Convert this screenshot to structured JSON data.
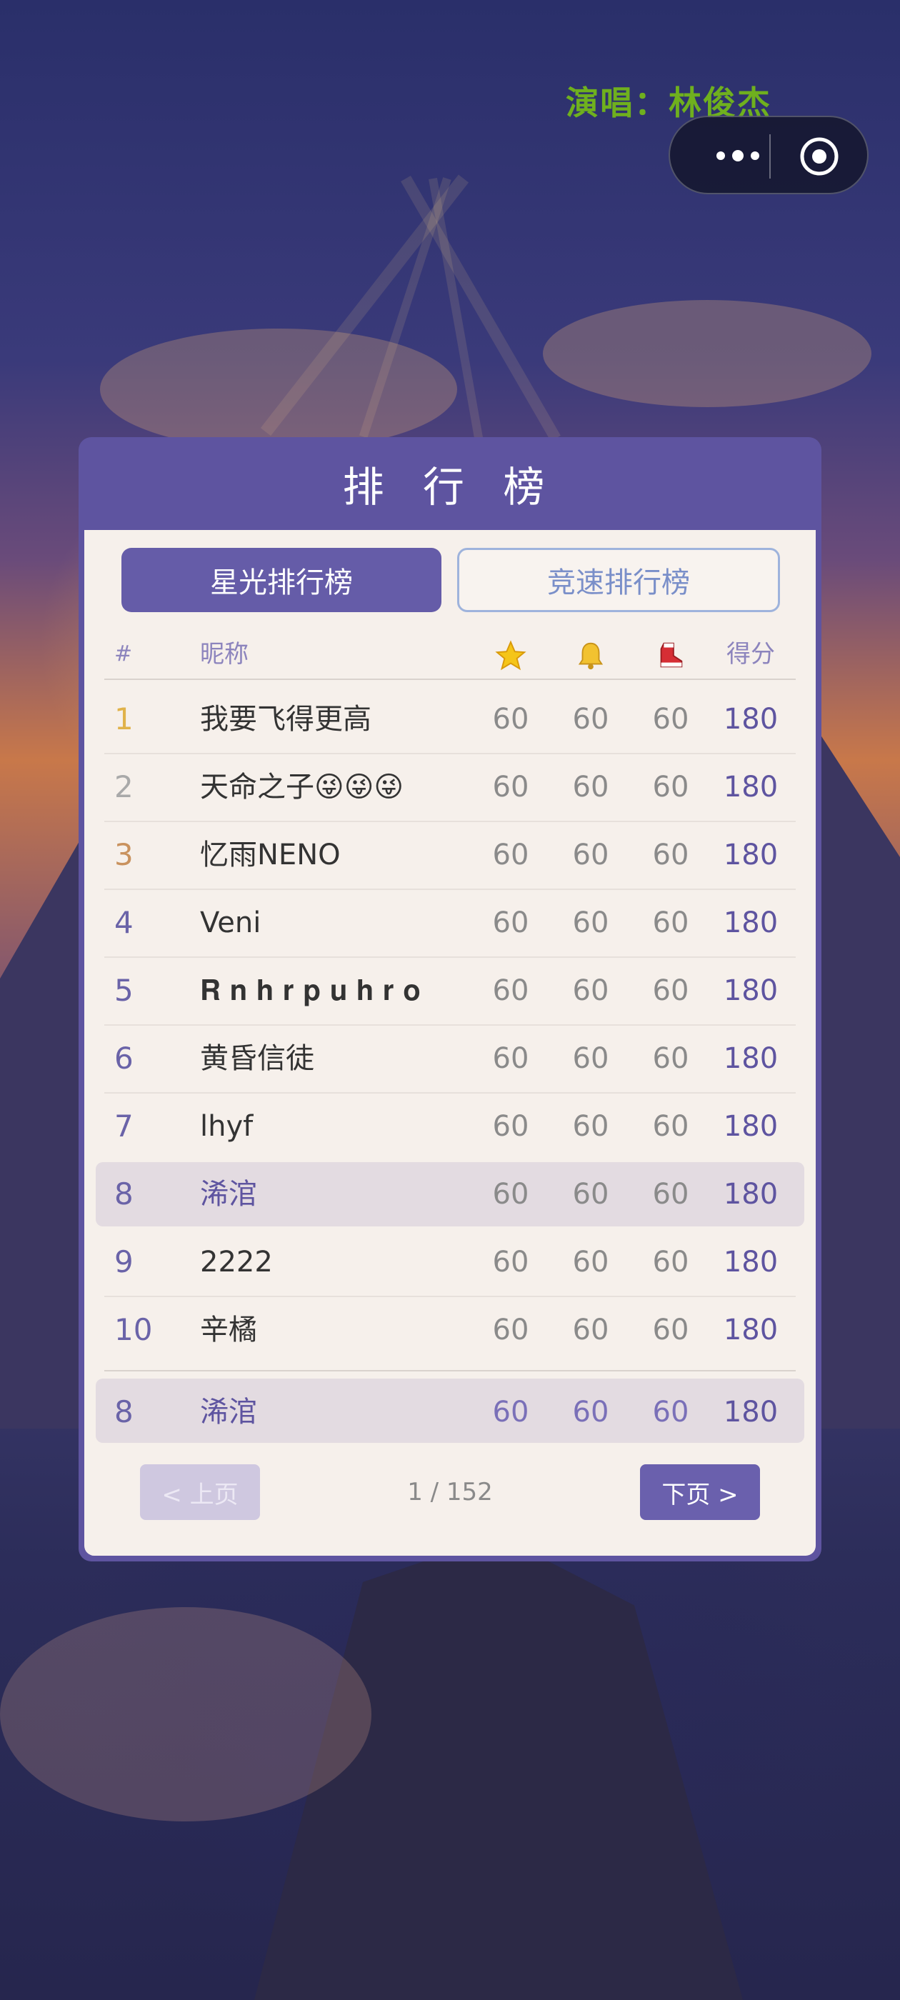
{
  "header": {
    "singer_label": "演唱：林俊杰"
  },
  "capsule": {
    "more_icon": "more-dots-icon",
    "close_icon": "target-icon"
  },
  "panel": {
    "title": "排 行 榜",
    "tabs": [
      {
        "label": "星光排行榜",
        "active": true
      },
      {
        "label": "竞速排行榜",
        "active": false
      }
    ],
    "columns": {
      "rank": "#",
      "name": "昵称",
      "col1_icon": "star-icon",
      "col2_icon": "bell-icon",
      "col3_icon": "boot-icon",
      "score": "得分"
    },
    "rows": [
      {
        "rank": "1",
        "name": "我要飞得更高",
        "v1": "60",
        "v2": "60",
        "v3": "60",
        "score": "180",
        "rank_color": "#e0b24a"
      },
      {
        "rank": "2",
        "name": "天命之子😜😜😜",
        "v1": "60",
        "v2": "60",
        "v3": "60",
        "score": "180",
        "rank_color": "#a9a9a9"
      },
      {
        "rank": "3",
        "name": "忆雨NENO",
        "v1": "60",
        "v2": "60",
        "v3": "60",
        "score": "180",
        "rank_color": "#c9925e"
      },
      {
        "rank": "4",
        "name": "Veni",
        "v1": "60",
        "v2": "60",
        "v3": "60",
        "score": "180",
        "rank_color": "#6a63a8"
      },
      {
        "rank": "5",
        "name": "𝐑 𝐧 𝐡 𝐫 𝐩 𝐮 𝐡 𝐫 𝐨",
        "v1": "60",
        "v2": "60",
        "v3": "60",
        "score": "180",
        "rank_color": "#6a63a8"
      },
      {
        "rank": "6",
        "name": "黄昏信徒",
        "v1": "60",
        "v2": "60",
        "v3": "60",
        "score": "180",
        "rank_color": "#6a63a8"
      },
      {
        "rank": "7",
        "name": "lhyf",
        "v1": "60",
        "v2": "60",
        "v3": "60",
        "score": "180",
        "rank_color": "#6a63a8"
      },
      {
        "rank": "8",
        "name": "浠涫",
        "v1": "60",
        "v2": "60",
        "v3": "60",
        "score": "180",
        "rank_color": "#6a63a8"
      },
      {
        "rank": "9",
        "name": "2222",
        "v1": "60",
        "v2": "60",
        "v3": "60",
        "score": "180",
        "rank_color": "#6a63a8"
      },
      {
        "rank": "10",
        "name": "辛橘",
        "v1": "60",
        "v2": "60",
        "v3": "60",
        "score": "180",
        "rank_color": "#6a63a8"
      }
    ],
    "my_row": {
      "rank": "8",
      "name": "浠涫",
      "v1": "60",
      "v2": "60",
      "v3": "60",
      "score": "180"
    },
    "pagination": {
      "prev_label": "< 上页",
      "page_text": "1 / 152",
      "next_label": "下页 >"
    }
  },
  "colors": {
    "panel": "#5e54a0",
    "panel_inner": "#f6f0eb",
    "accent_green": "#6fb01e",
    "highlight_row": "#e3dbe1"
  }
}
